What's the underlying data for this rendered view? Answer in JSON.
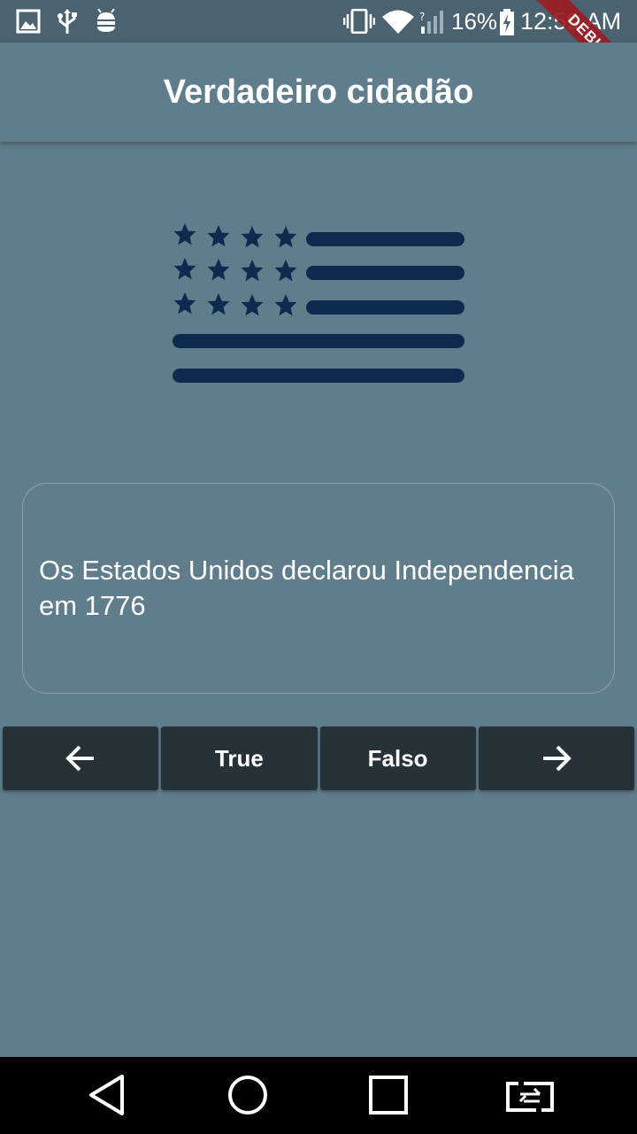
{
  "status_bar": {
    "icons": [
      "image-icon",
      "usb-icon",
      "android-debug-icon",
      "vibrate-icon",
      "wifi-icon",
      "cell-signal-icon",
      "battery-charging-icon"
    ],
    "battery_percent": "16%",
    "time": "12:59 AM"
  },
  "debug_banner": "DEBUG",
  "app_bar": {
    "title": "Verdadeiro cidadão"
  },
  "question": {
    "text": "Os Estados Unidos declarou Independencia em 1776"
  },
  "buttons": {
    "previous_icon": "arrow-left-icon",
    "true_label": "True",
    "false_label": "Falso",
    "next_icon": "arrow-right-icon"
  },
  "nav_bar": {
    "icons": [
      "back-icon",
      "home-icon",
      "recents-icon",
      "screen-rotate-icon"
    ]
  },
  "colors": {
    "background": "#607d8b",
    "button": "#263238",
    "flag": "#0d2a4f"
  }
}
